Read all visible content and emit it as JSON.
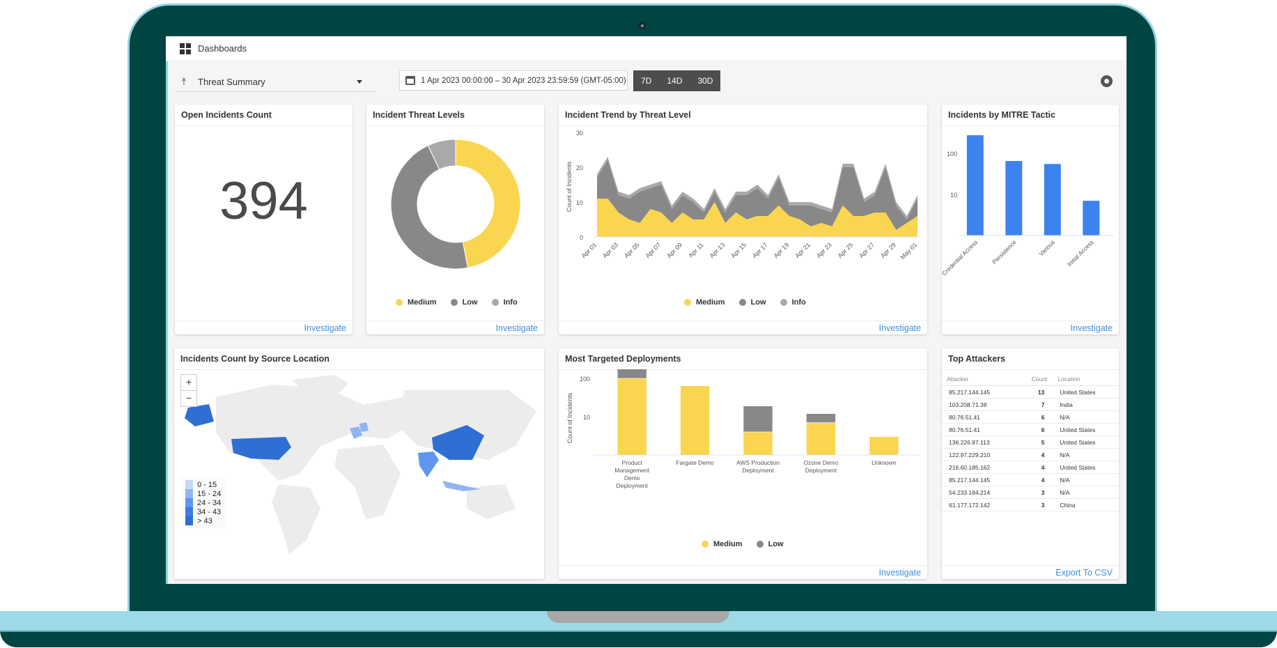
{
  "app": {
    "title": "Dashboards",
    "dashboard_selector": {
      "value": "Threat Summary"
    },
    "date_range": "1 Apr 2023 00:00:00 – 30 Apr 2023 23:59:59 (GMT-05:00)",
    "range_buttons": [
      "7D",
      "14D",
      "30D"
    ]
  },
  "icons": {
    "dashboards": "grid-icon",
    "selector": "pin-icon",
    "calendar": "calendar-icon",
    "aperture": "aperture-icon",
    "camera": "webcam"
  },
  "colors": {
    "medium": "#f9d550",
    "low": "#888888",
    "info": "#a9a9a9",
    "bar": "#3d83f0",
    "link": "#3d8fd6",
    "bezel": "#014542",
    "base": "#9dd9e6"
  },
  "panels": {
    "open_incidents": {
      "title": "Open Incidents Count",
      "value": "394",
      "link": "Investigate"
    },
    "threat_levels": {
      "title": "Incident Threat Levels",
      "link": "Investigate"
    },
    "trend": {
      "title": "Incident Trend by Threat Level",
      "link": "Investigate"
    },
    "mitre": {
      "title": "Incidents by MITRE Tactic",
      "link": "Investigate"
    },
    "map": {
      "title": "Incidents Count by Source Location",
      "zoom_in": "+",
      "zoom_out": "−",
      "legend": [
        {
          "label": "0 - 15",
          "color": "#c5d8f7"
        },
        {
          "label": "15 - 24",
          "color": "#8fb5f2"
        },
        {
          "label": "24 - 34",
          "color": "#5f97ef"
        },
        {
          "label": "34 - 43",
          "color": "#3c7ce6"
        },
        {
          "label": "> 43",
          "color": "#2f6ed2"
        }
      ],
      "highlighted": [
        {
          "region": "United States",
          "bucket": "> 43"
        },
        {
          "region": "China",
          "bucket": "> 43"
        },
        {
          "region": "India",
          "bucket": "24 - 34"
        },
        {
          "region": "France",
          "bucket": "15 - 24"
        },
        {
          "region": "Germany",
          "bucket": "15 - 24"
        },
        {
          "region": "Indonesia",
          "bucket": "15 - 24"
        }
      ]
    },
    "deployments": {
      "title": "Most Targeted Deployments",
      "link": "Investigate"
    },
    "attackers": {
      "title": "Top Attackers",
      "columns": [
        "Attacker",
        "Count",
        "Location"
      ],
      "rows": [
        [
          "85.217.144.145",
          "13",
          "United States"
        ],
        [
          "103.208.71.38",
          "7",
          "India"
        ],
        [
          "80.76.51.41",
          "6",
          "N/A"
        ],
        [
          "80.76.51.41",
          "6",
          "United States"
        ],
        [
          "136.226.87.113",
          "5",
          "United States"
        ],
        [
          "122.97.229.210",
          "4",
          "N/A"
        ],
        [
          "216.60.185.162",
          "4",
          "United States"
        ],
        [
          "85.217.144.145",
          "4",
          "N/A"
        ],
        [
          "54.233.184.214",
          "3",
          "N/A"
        ],
        [
          "61.177.172.142",
          "3",
          "China"
        ]
      ],
      "link": "Export To CSV"
    }
  },
  "chart_data": [
    {
      "id": "threat_levels",
      "type": "pie",
      "title": "Incident Threat Levels",
      "donut": true,
      "categories": [
        "Medium",
        "Low",
        "Info"
      ],
      "values": [
        47,
        46,
        7
      ],
      "unit": "percent (estimated)",
      "legend": "bottom"
    },
    {
      "id": "trend",
      "type": "area",
      "stacked": true,
      "title": "Incident Trend by Threat Level",
      "xlabel": "",
      "ylabel": "Count of Incidents",
      "ylim": [
        0,
        30
      ],
      "yticks": [
        "0",
        "10",
        "20",
        "30"
      ],
      "x": [
        "Apr 01",
        "Apr 02",
        "Apr 03",
        "Apr 04",
        "Apr 05",
        "Apr 06",
        "Apr 07",
        "Apr 08",
        "Apr 09",
        "Apr 10",
        "Apr 11",
        "Apr 12",
        "Apr 13",
        "Apr 14",
        "Apr 15",
        "Apr 16",
        "Apr 17",
        "Apr 18",
        "Apr 19",
        "Apr 20",
        "Apr 21",
        "Apr 22",
        "Apr 23",
        "Apr 24",
        "Apr 25",
        "Apr 26",
        "Apr 27",
        "Apr 28",
        "Apr 29",
        "Apr 30",
        "May 01"
      ],
      "xticks": [
        "Apr 01",
        "Apr 03",
        "Apr 05",
        "Apr 07",
        "Apr 09",
        "Apr 11",
        "Apr 13",
        "Apr 15",
        "Apr 17",
        "Apr 19",
        "Apr 21",
        "Apr 23",
        "Apr 25",
        "Apr 27",
        "Apr 29",
        "May 01"
      ],
      "series": [
        {
          "name": "Medium",
          "values": [
            11,
            11,
            7,
            5,
            4,
            8,
            7,
            4,
            7,
            5,
            5,
            10,
            4,
            7,
            5,
            6,
            6,
            9,
            6,
            5,
            3,
            4,
            3,
            9,
            6,
            6,
            7,
            7,
            2,
            4,
            6
          ]
        },
        {
          "name": "Low",
          "values": [
            6,
            11,
            5,
            6,
            9,
            6,
            8,
            4,
            5,
            5,
            2,
            3,
            3,
            5,
            7,
            8,
            5,
            8,
            3,
            4,
            6,
            4,
            4,
            11,
            14,
            4,
            5,
            13,
            7,
            1,
            5
          ]
        },
        {
          "name": "Info",
          "values": [
            1,
            1,
            1,
            1,
            1,
            1,
            1,
            1,
            1,
            1,
            1,
            1,
            1,
            1,
            1,
            1,
            1,
            1,
            1,
            1,
            1,
            1,
            1,
            1,
            1,
            1,
            1,
            1,
            1,
            1,
            1
          ]
        }
      ],
      "legend": "bottom",
      "grid": false
    },
    {
      "id": "mitre",
      "type": "bar",
      "title": "Incidents by MITRE Tactic",
      "yscale": "log",
      "ylim": [
        1,
        1000
      ],
      "yticks": [
        "10",
        "100",
        "1k"
      ],
      "categories": [
        "Credential Access",
        "Persistence",
        "Various",
        "Initial Access"
      ],
      "values": [
        275,
        65,
        55,
        7
      ]
    },
    {
      "id": "deployments",
      "type": "bar",
      "stacked": true,
      "title": "Most Targeted Deployments",
      "ylabel": "Count of Incidents",
      "yscale": "log",
      "ylim": [
        1,
        1000
      ],
      "yticks": [
        "10",
        "100",
        "1k"
      ],
      "categories": [
        "Product Management Demo Deployment",
        "Fargate Demo",
        "AWS Production Deployment",
        "Ozone Demo Deployment",
        "Unknown"
      ],
      "series": [
        {
          "name": "Medium",
          "values": [
            100,
            64,
            4,
            7,
            3
          ]
        },
        {
          "name": "Low",
          "values": [
            170,
            0,
            15,
            5,
            0
          ]
        }
      ],
      "legend": "bottom"
    }
  ]
}
